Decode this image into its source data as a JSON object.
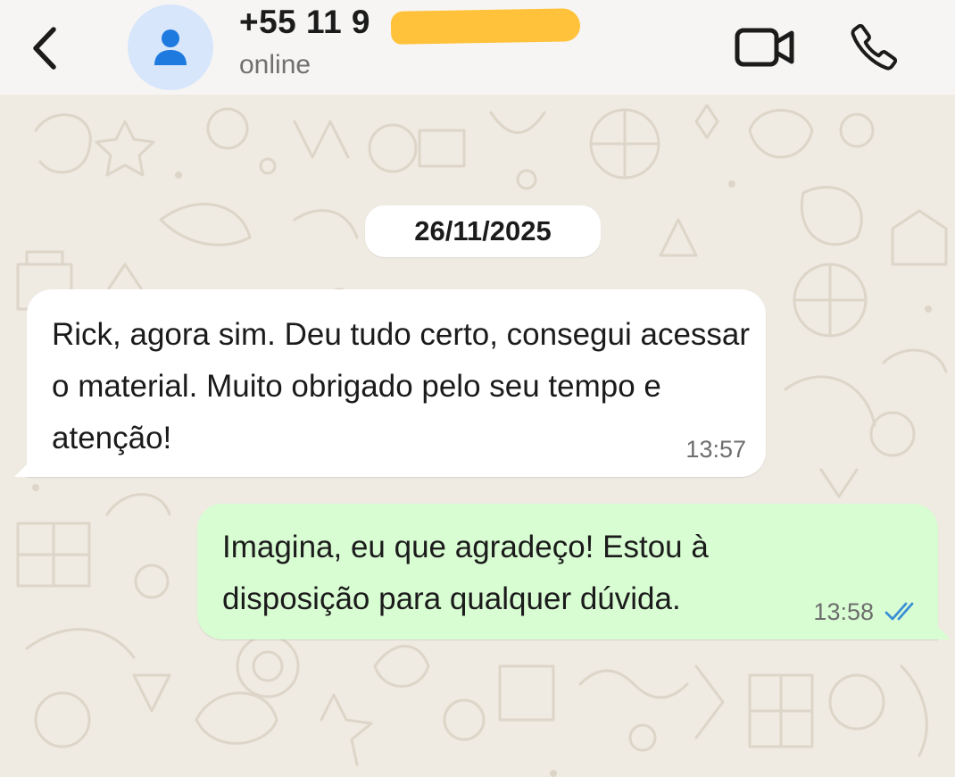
{
  "header": {
    "back_icon": "chevron-left-icon",
    "avatar_icon": "person-icon",
    "contact_name": "+55 11 9",
    "contact_status": "online",
    "video_icon": "video-camera-icon",
    "call_icon": "phone-icon"
  },
  "chat": {
    "date_label": "26/11/2025",
    "messages": [
      {
        "direction": "incoming",
        "text": "Rick, agora sim. Deu tudo certo, consegui acessar o material. Muito obrigado pelo seu tempo e atenção!",
        "time": "13:57"
      },
      {
        "direction": "outgoing",
        "text": "Imagina, eu que agradeço! Estou à disposição para qualquer dúvida.",
        "time": "13:58",
        "status_icon": "double-check-read-icon"
      }
    ]
  },
  "colors": {
    "header_bg": "#f7f5f3",
    "chat_bg": "#efeae2",
    "incoming_bubble": "#ffffff",
    "outgoing_bubble": "#d9fdd3",
    "avatar_bg": "#d7e6fb",
    "avatar_icon": "#1f7ae0",
    "read_ticks": "#3b8fd6",
    "redaction": "#ffc23a"
  }
}
